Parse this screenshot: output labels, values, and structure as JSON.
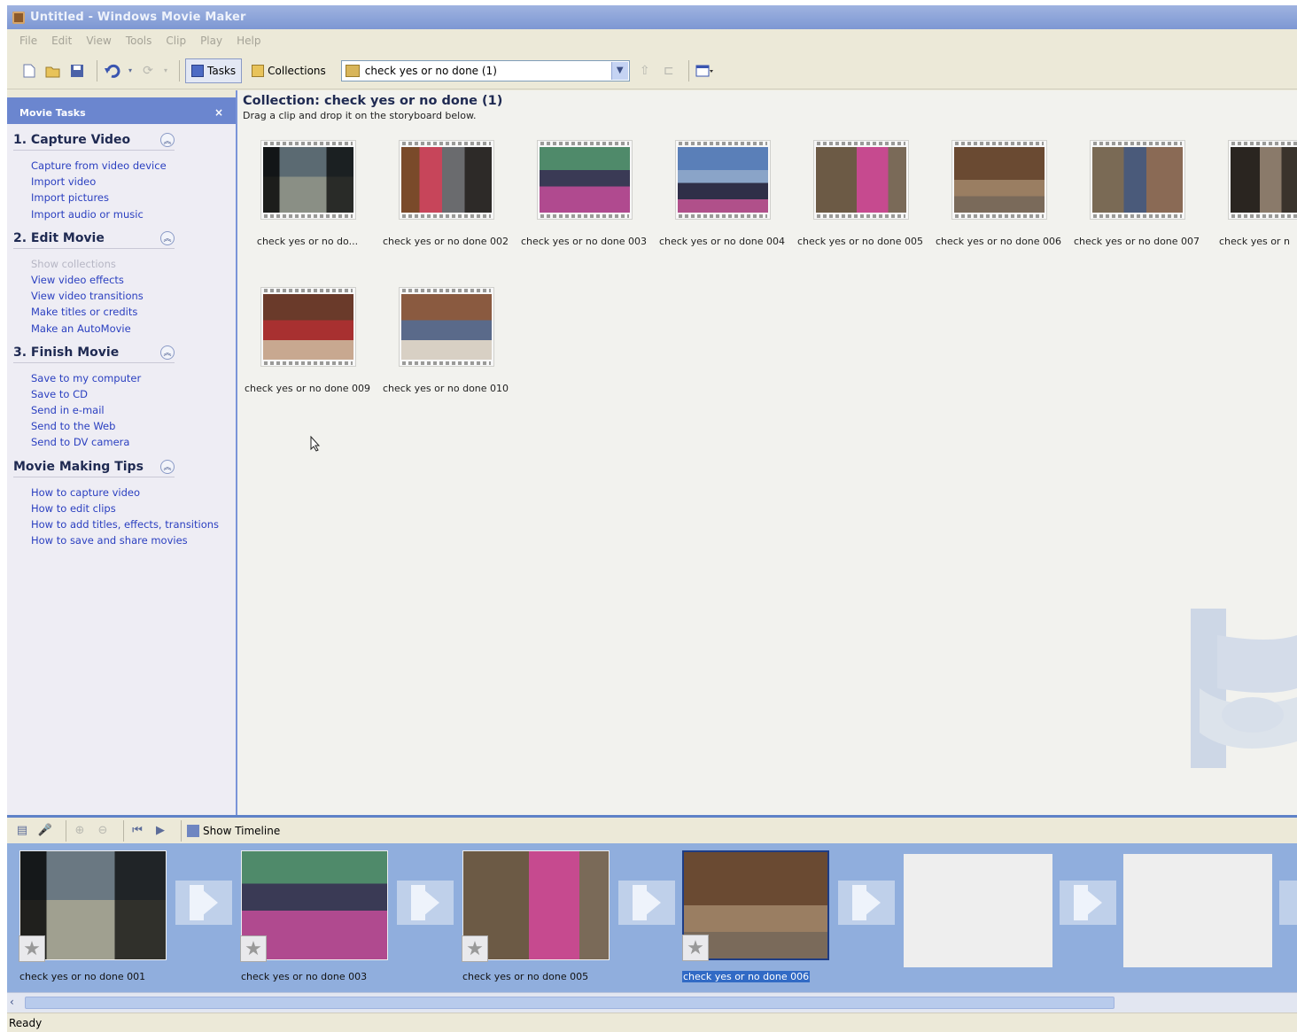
{
  "window": {
    "title": "Untitled - Windows Movie Maker"
  },
  "menu": [
    "File",
    "Edit",
    "View",
    "Tools",
    "Clip",
    "Play",
    "Help"
  ],
  "toolbar": {
    "tasks_label": "Tasks",
    "collections_label": "Collections",
    "collection_value": "check yes or no done (1)"
  },
  "tasks_pane": {
    "header": "Movie Tasks",
    "close": "×",
    "groups": [
      {
        "title": "1. Capture Video",
        "links": [
          "Capture from video device",
          "Import video",
          "Import pictures",
          "Import audio or music"
        ]
      },
      {
        "title": "2. Edit Movie",
        "links": [
          "Show collections",
          "View video effects",
          "View video transitions",
          "Make titles or credits",
          "Make an AutoMovie"
        ]
      },
      {
        "title": "3. Finish Movie",
        "links": [
          "Save to my computer",
          "Save to CD",
          "Send in e-mail",
          "Send to the Web",
          "Send to DV camera"
        ]
      },
      {
        "title": "Movie Making Tips",
        "links": [
          "How to capture video",
          "How to edit clips",
          "How to add titles, effects, transitions",
          "How to save and share movies"
        ]
      }
    ]
  },
  "collection": {
    "title": "Collection: check yes or no done (1)",
    "hint": "Drag a clip and drop it on the storyboard below.",
    "clips": [
      "check yes or no do...",
      "check yes or no done 002",
      "check yes or no done 003",
      "check yes or no done 004",
      "check yes or no done 005",
      "check yes or no done 006",
      "check yes or no done 007",
      "check yes or n",
      "check yes or no done 009",
      "check yes or no done 010"
    ]
  },
  "storyboard": {
    "show_timeline_label": "Show Timeline",
    "clips": [
      "check yes or no done 001",
      "check yes or no done 003",
      "check yes or no done 005",
      "check yes or no done 006"
    ],
    "selected_index": 3
  },
  "status": {
    "text": "Ready"
  },
  "colors": {
    "accent": "#316ac5",
    "pane_header": "#6b86cf",
    "storyboard_bg": "#90aedd",
    "link": "#2a3fc0"
  }
}
